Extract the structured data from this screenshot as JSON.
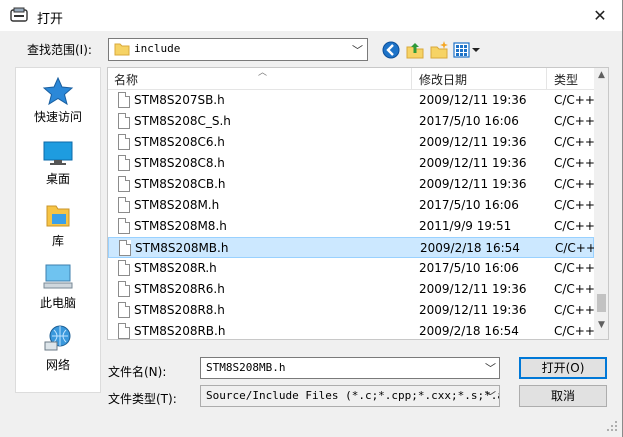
{
  "window": {
    "title": "打开",
    "close_glyph": "✕"
  },
  "look_in": {
    "label": "查找范围(I):",
    "value": "include"
  },
  "toolbar": {
    "back_icon": "back-icon",
    "up_icon": "up-folder-icon",
    "new_folder_icon": "new-folder-icon",
    "view_icon": "view-menu-icon"
  },
  "places": [
    {
      "label": "快速访问",
      "icon": "star-icon"
    },
    {
      "label": "桌面",
      "icon": "desktop-icon"
    },
    {
      "label": "库",
      "icon": "library-icon"
    },
    {
      "label": "此电脑",
      "icon": "computer-icon"
    },
    {
      "label": "网络",
      "icon": "network-icon"
    }
  ],
  "columns": {
    "name": "名称",
    "date": "修改日期",
    "type": "类型"
  },
  "files": [
    {
      "name": "STM8S207SB.h",
      "date": "2009/12/11 19:36",
      "type": "C/C++"
    },
    {
      "name": "STM8S208C_S.h",
      "date": "2017/5/10 16:06",
      "type": "C/C++"
    },
    {
      "name": "STM8S208C6.h",
      "date": "2009/12/11 19:36",
      "type": "C/C++"
    },
    {
      "name": "STM8S208C8.h",
      "date": "2009/12/11 19:36",
      "type": "C/C++"
    },
    {
      "name": "STM8S208CB.h",
      "date": "2009/12/11 19:36",
      "type": "C/C++"
    },
    {
      "name": "STM8S208M.h",
      "date": "2017/5/10 16:06",
      "type": "C/C++"
    },
    {
      "name": "STM8S208M8.h",
      "date": "2011/9/9 19:51",
      "type": "C/C++"
    },
    {
      "name": "STM8S208MB.h",
      "date": "2009/2/18 16:54",
      "type": "C/C++",
      "selected": true
    },
    {
      "name": "STM8S208R.h",
      "date": "2017/5/10 16:06",
      "type": "C/C++"
    },
    {
      "name": "STM8S208R6.h",
      "date": "2009/12/11 19:36",
      "type": "C/C++"
    },
    {
      "name": "STM8S208R8.h",
      "date": "2009/12/11 19:36",
      "type": "C/C++"
    },
    {
      "name": "STM8S208RB.h",
      "date": "2009/2/18 16:54",
      "type": "C/C++"
    }
  ],
  "file_name": {
    "label": "文件名(N):",
    "value": "STM8S208MB.h"
  },
  "file_type": {
    "label": "文件类型(T):",
    "value": "Source/Include Files (*.c;*.cpp;*.cxx;*.s;*.as"
  },
  "buttons": {
    "open": "打开(O)",
    "cancel": "取消"
  },
  "colors": {
    "selection_bg": "#cce8ff",
    "selection_border": "#99d1ff",
    "accent": "#0078d7"
  }
}
